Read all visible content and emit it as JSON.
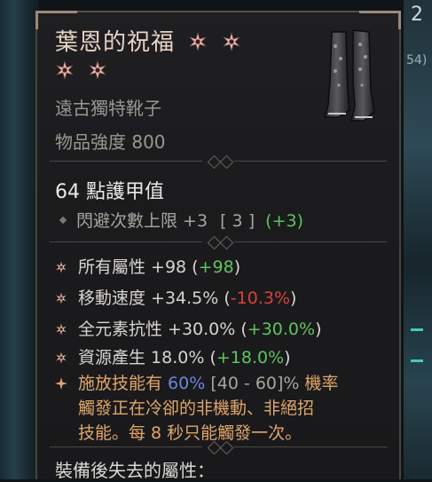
{
  "background": {
    "right_number_top": "2",
    "right_number_small": "54)"
  },
  "item": {
    "name": "葉恩的祝福",
    "subtype": "遠古獨特靴子",
    "power": "物品強度 800",
    "armor": "64 點護甲值",
    "implicit": {
      "text": "閃避次數上限 +3",
      "bracket": "[ 3 ]",
      "delta": "(+3)"
    },
    "affixes": [
      {
        "label": "所有屬性 +98",
        "delta": "+98",
        "delta_color": "green"
      },
      {
        "label": "移動速度 +34.5%",
        "delta": "-10.3%",
        "delta_color": "red"
      },
      {
        "label": "全元素抗性 +30.0%",
        "delta": "+30.0%",
        "delta_color": "green"
      },
      {
        "label": "資源產生 18.0%",
        "delta": "+18.0%",
        "delta_color": "green"
      }
    ],
    "unique": {
      "prefix": "施放技能有 ",
      "value": "60%",
      "range": " [40 - 60]% ",
      "suffix_line1": "機率",
      "line2": "觸發正在冷卻的非機動、非絕招",
      "line3": "技能。每 8 秒只能觸發一次。"
    },
    "lost_stats_label": "裝備後失去的屬性："
  },
  "colors": {
    "green": "#5ec45a",
    "red": "#d9413a",
    "blue": "#6b86e0",
    "unique_orange": "#e0a66a",
    "star_pink": "#e7b7ad"
  },
  "icons": {
    "rarity_stars": [
      "flower-star-icon",
      "flower-star-icon",
      "flower-star-icon",
      "flower-star-icon"
    ],
    "affix_bullet": "flower-star-icon",
    "unique_bullet": "sparkle-star-icon",
    "implicit_bullet": "diamond-icon",
    "item_image": "boots-icon"
  }
}
